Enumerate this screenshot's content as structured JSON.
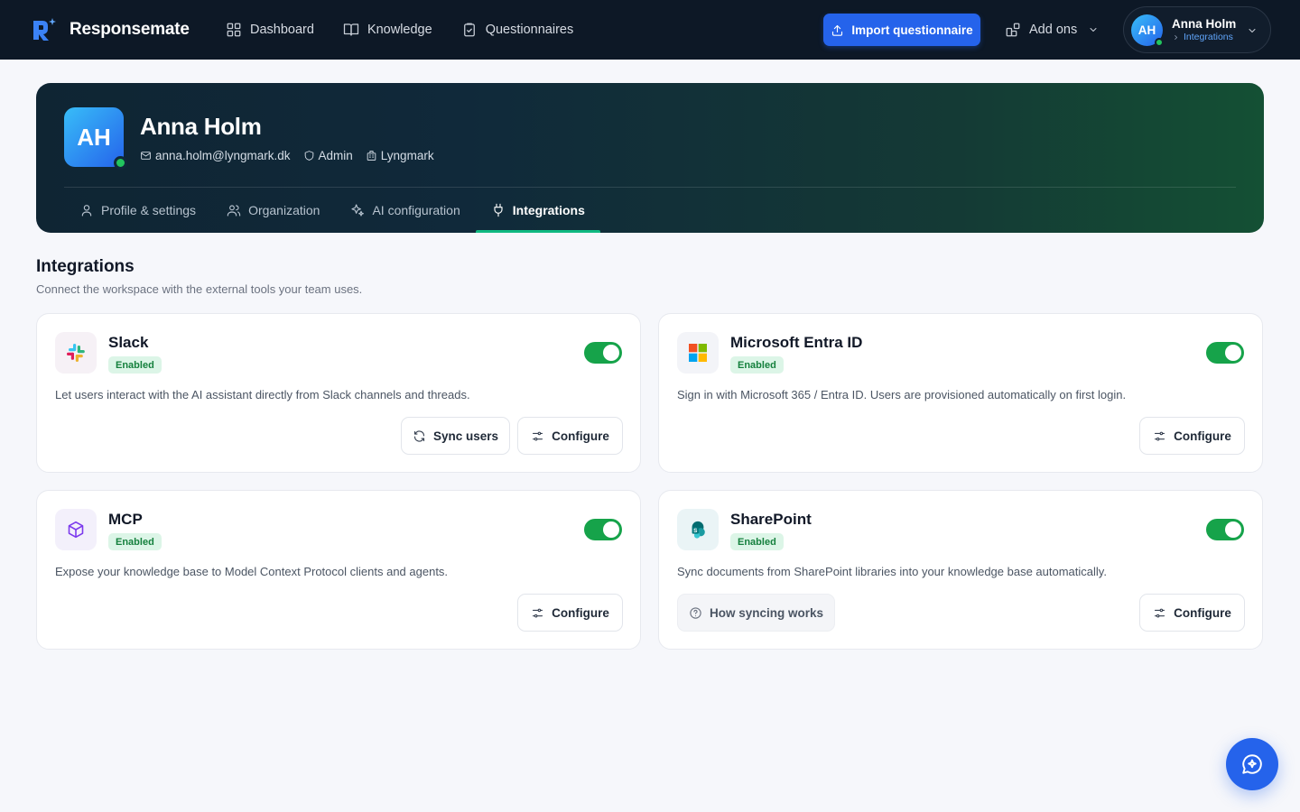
{
  "app": {
    "name": "Responsemate"
  },
  "nav": {
    "items": [
      {
        "label": "Dashboard",
        "icon": "grid-icon"
      },
      {
        "label": "Knowledge",
        "icon": "book-icon"
      },
      {
        "label": "Questionnaires",
        "icon": "clipboard-icon"
      }
    ],
    "import_label": "Import questionnaire",
    "addons_label": "Add ons"
  },
  "user": {
    "initials": "AH",
    "name": "Anna Holm",
    "crumb": "Integrations",
    "email": "anna.holm@lyngmark.dk",
    "role": "Admin",
    "org": "Lyngmark"
  },
  "profile_tabs": [
    {
      "label": "Profile & settings",
      "active": false
    },
    {
      "label": "Organization",
      "active": false
    },
    {
      "label": "AI configuration",
      "active": false
    },
    {
      "label": "Integrations",
      "active": true
    }
  ],
  "section": {
    "title": "Integrations",
    "subtitle": "Connect the workspace with the external tools your team uses."
  },
  "integrations": [
    {
      "name": "Slack",
      "status": "Enabled",
      "enabled": true,
      "description": "Let users interact with the AI assistant directly from Slack channels and threads.",
      "secondary_label": "Sync users",
      "configure_label": "Configure"
    },
    {
      "name": "Microsoft Entra ID",
      "status": "Enabled",
      "enabled": true,
      "description": "Sign in with Microsoft 365 / Entra ID. Users are provisioned automatically on first login.",
      "configure_label": "Configure"
    },
    {
      "name": "MCP",
      "status": "Enabled",
      "enabled": true,
      "description": "Expose your knowledge base to Model Context Protocol clients and agents.",
      "configure_label": "Configure"
    },
    {
      "name": "SharePoint",
      "status": "Enabled",
      "enabled": true,
      "description": "Sync documents from SharePoint libraries into your knowledge base automatically.",
      "help_label": "How syncing works",
      "configure_label": "Configure"
    }
  ],
  "colors": {
    "topbar": "#0d1826",
    "accent": "#2563eb",
    "toggle_on": "#16a34a",
    "active_tab_underline": "#10b981"
  }
}
